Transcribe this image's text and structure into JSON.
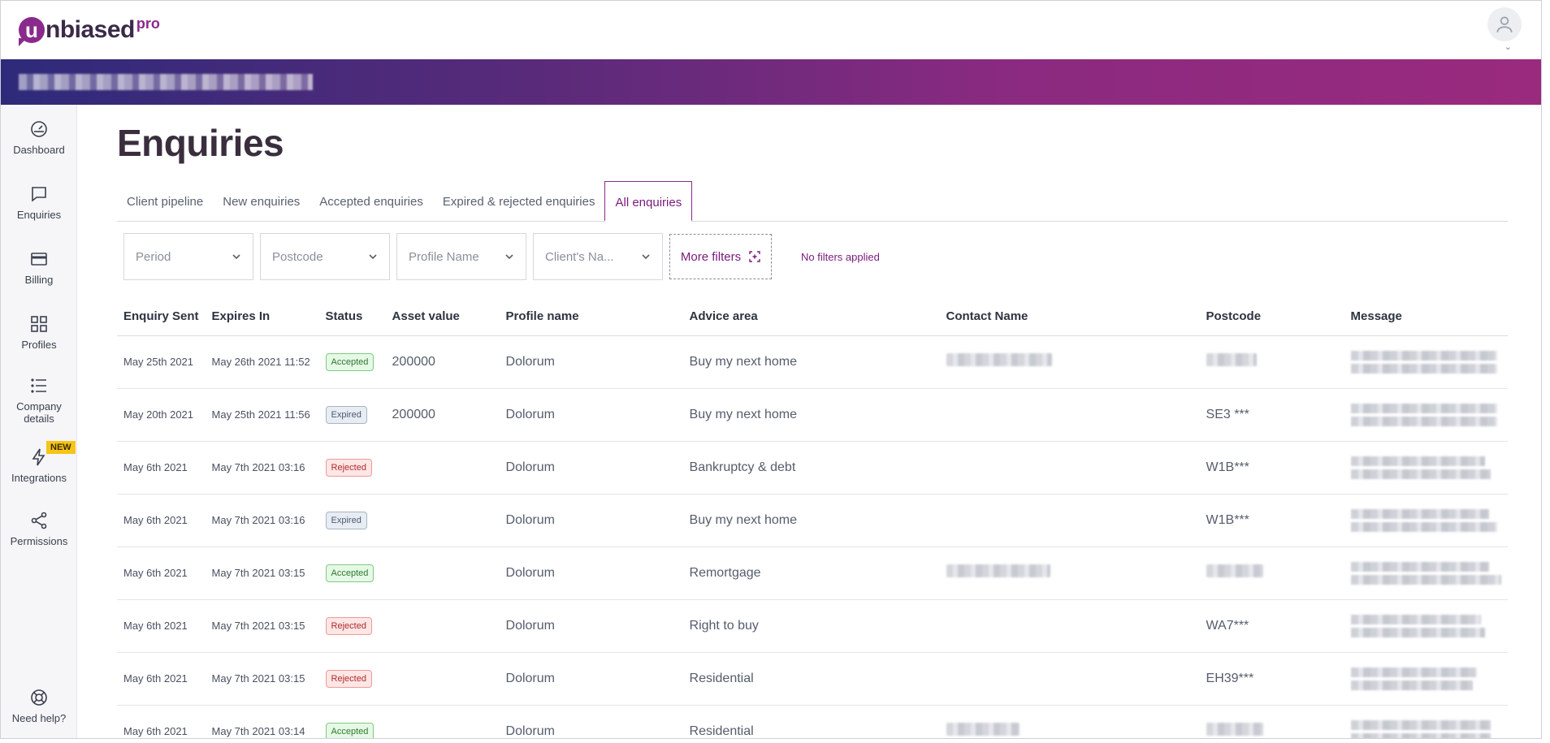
{
  "brand": {
    "name": "nbiased",
    "mark": "u",
    "suffix": "pro"
  },
  "icons": {
    "avatar": "user-icon",
    "caret": "chevron-down-icon"
  },
  "sidebar": {
    "items": [
      {
        "label": "Dashboard",
        "icon": "dashboard-gauge-icon"
      },
      {
        "label": "Enquiries",
        "icon": "chat-bubble-icon"
      },
      {
        "label": "Billing",
        "icon": "credit-card-icon"
      },
      {
        "label": "Profiles",
        "icon": "grid-icon"
      },
      {
        "label": "Company details",
        "icon": "list-icon"
      },
      {
        "label": "Integrations",
        "icon": "lightning-icon",
        "badge": "NEW"
      },
      {
        "label": "Permissions",
        "icon": "share-icon"
      },
      {
        "label": "Need help?",
        "icon": "lifebuoy-icon"
      }
    ]
  },
  "page": {
    "title": "Enquiries"
  },
  "tabs": [
    {
      "label": "Client pipeline"
    },
    {
      "label": "New enquiries"
    },
    {
      "label": "Accepted enquiries"
    },
    {
      "label": "Expired & rejected enquiries"
    },
    {
      "label": "All enquiries",
      "active": true
    }
  ],
  "filters": {
    "selects": [
      {
        "placeholder": "Period"
      },
      {
        "placeholder": "Postcode"
      },
      {
        "placeholder": "Profile Name"
      },
      {
        "placeholder": "Client's Na..."
      }
    ],
    "more_filters_label": "More filters",
    "status_text": "No filters applied"
  },
  "table": {
    "headers": [
      "Enquiry Sent",
      "Expires In",
      "Status",
      "Asset value",
      "Profile name",
      "Advice area",
      "Contact Name",
      "Postcode",
      "Message"
    ],
    "rows": [
      {
        "sent": "May 25th 2021",
        "expires": "May 26th 2021 11:52",
        "status": "Accepted",
        "asset": "200000",
        "profile": "Dolorum",
        "advice": "Buy my next home",
        "postcode": ""
      },
      {
        "sent": "May 20th 2021",
        "expires": "May 25th 2021 11:56",
        "status": "Expired",
        "asset": "200000",
        "profile": "Dolorum",
        "advice": "Buy my next home",
        "postcode": "SE3 ***"
      },
      {
        "sent": "May 6th 2021",
        "expires": "May 7th 2021 03:16",
        "status": "Rejected",
        "asset": "",
        "profile": "Dolorum",
        "advice": "Bankruptcy & debt",
        "postcode": "W1B***"
      },
      {
        "sent": "May 6th 2021",
        "expires": "May 7th 2021 03:16",
        "status": "Expired",
        "asset": "",
        "profile": "Dolorum",
        "advice": "Buy my next home",
        "postcode": "W1B***"
      },
      {
        "sent": "May 6th 2021",
        "expires": "May 7th 2021 03:15",
        "status": "Accepted",
        "asset": "",
        "profile": "Dolorum",
        "advice": "Remortgage",
        "postcode": ""
      },
      {
        "sent": "May 6th 2021",
        "expires": "May 7th 2021 03:15",
        "status": "Rejected",
        "asset": "",
        "profile": "Dolorum",
        "advice": "Right to buy",
        "postcode": "WA7***"
      },
      {
        "sent": "May 6th 2021",
        "expires": "May 7th 2021 03:15",
        "status": "Rejected",
        "asset": "",
        "profile": "Dolorum",
        "advice": "Residential",
        "postcode": "EH39***"
      },
      {
        "sent": "May 6th 2021",
        "expires": "May 7th 2021 03:14",
        "status": "Accepted",
        "asset": "",
        "profile": "Dolorum",
        "advice": "Residential",
        "postcode": ""
      }
    ]
  },
  "colors": {
    "brand_purple": "#8a2a8c",
    "accepted": "#2d7a2d",
    "expired": "#4a5a70",
    "rejected": "#b02a2a"
  }
}
